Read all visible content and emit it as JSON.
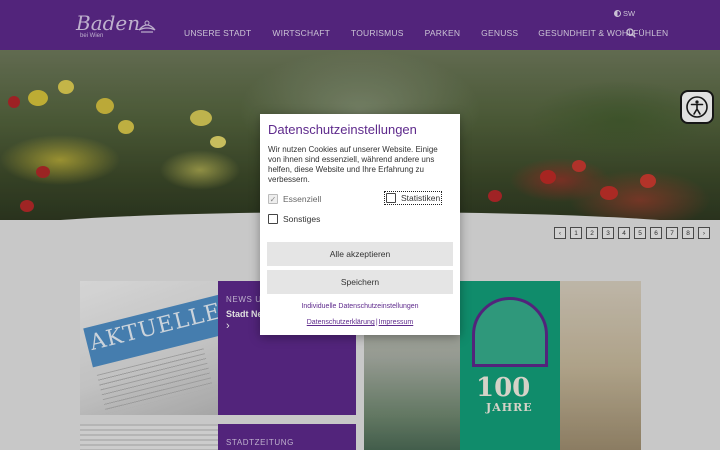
{
  "header": {
    "logo_text": "Baden",
    "logo_sub": "bei Wien",
    "sw_label": "SW",
    "nav": [
      "UNSERE STADT",
      "WIRTSCHAFT",
      "TOURISMUS",
      "PARKEN",
      "GENUSS",
      "GESUNDHEIT & WOHLFÜHLEN"
    ],
    "search_icon": "search-icon"
  },
  "pager": {
    "prev_label": "‹",
    "pages": [
      "1",
      "2",
      "3",
      "4",
      "5",
      "6",
      "7",
      "8"
    ],
    "next_label": "›"
  },
  "content": {
    "news_caption": "NEWS UND",
    "news_title": "Stadt Ne",
    "news_arrow": "›",
    "news_image_text": "AKTUELLES",
    "stz_caption": "STADTZEITUNG",
    "poster_number": "100",
    "poster_word": "JAHRE"
  },
  "consent": {
    "title": "Datenschutzeinstellungen",
    "text": "Wir nutzen Cookies auf unserer Website. Einige von ihnen sind essenziell, während andere uns helfen, diese Website und Ihre Erfahrung zu verbessern.",
    "options": [
      {
        "label": "Essenziell",
        "checked": true,
        "disabled": true
      },
      {
        "label": "Statistiken",
        "checked": false,
        "disabled": false
      },
      {
        "label": "Sonstiges",
        "checked": false,
        "disabled": false
      }
    ],
    "accept_all": "Alle akzeptieren",
    "save": "Speichern",
    "individual_link": "Individuelle Datenschutzeinstellungen",
    "privacy_link": "Datenschutzerklärung",
    "link_separator": "|",
    "imprint_link": "Impressum"
  },
  "colors": {
    "brand_purple": "#5e2a8c",
    "button_gray": "#e5e5e5"
  }
}
